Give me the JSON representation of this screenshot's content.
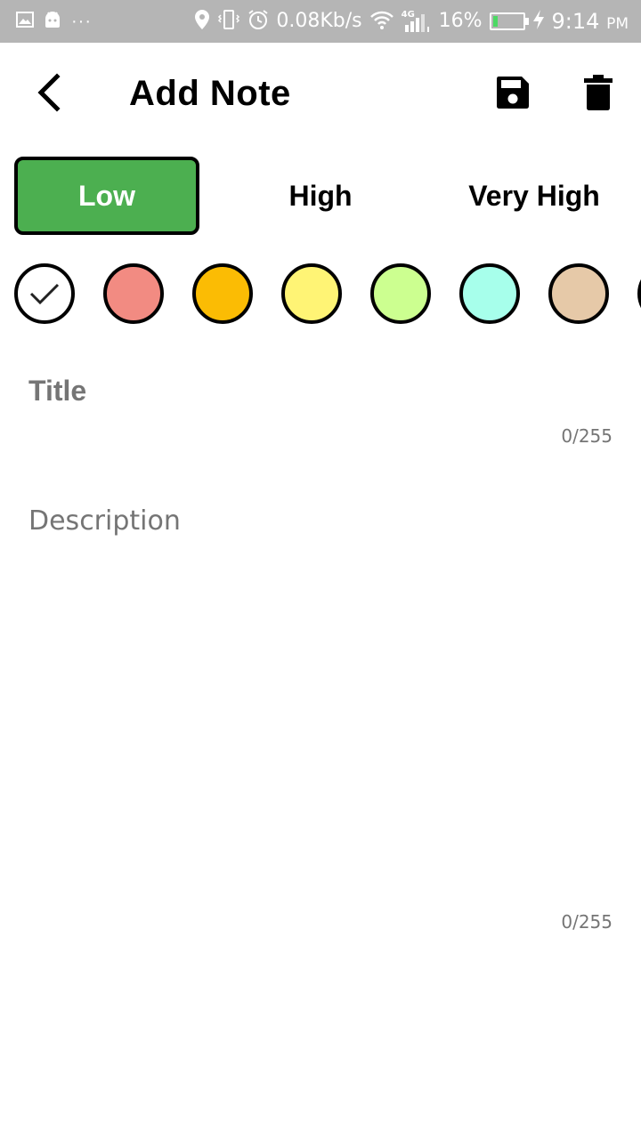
{
  "status_bar": {
    "network_speed": "0.08Kb/s",
    "network_type": "4G",
    "battery_percent": "16%",
    "battery_level": 0.16,
    "time": "9:14",
    "ampm": "PM",
    "more_dots": "···",
    "icons": [
      "gallery-icon",
      "android-icon",
      "location-icon",
      "vibrate-icon",
      "alarm-icon",
      "wifi-icon",
      "signal-icon",
      "battery-icon",
      "charging-icon"
    ]
  },
  "app_bar": {
    "title": "Add Note",
    "icons": [
      "back-arrow-icon",
      "save-icon",
      "delete-icon"
    ]
  },
  "priority": {
    "options": [
      {
        "label": "Low",
        "selected": true
      },
      {
        "label": "High",
        "selected": false
      },
      {
        "label": "Very High",
        "selected": false
      }
    ],
    "selected_color": "#4caf50"
  },
  "colors": {
    "swatches": [
      "#ffffff",
      "#f28b82",
      "#fbbc04",
      "#fff475",
      "#ccff90",
      "#a7ffeb",
      "#e6c9a8",
      "#ffffff"
    ],
    "selected_index": 0
  },
  "title_field": {
    "placeholder": "Title",
    "value": "",
    "counter": "0/255"
  },
  "description_field": {
    "placeholder": "Description",
    "value": "",
    "counter": "0/255"
  }
}
